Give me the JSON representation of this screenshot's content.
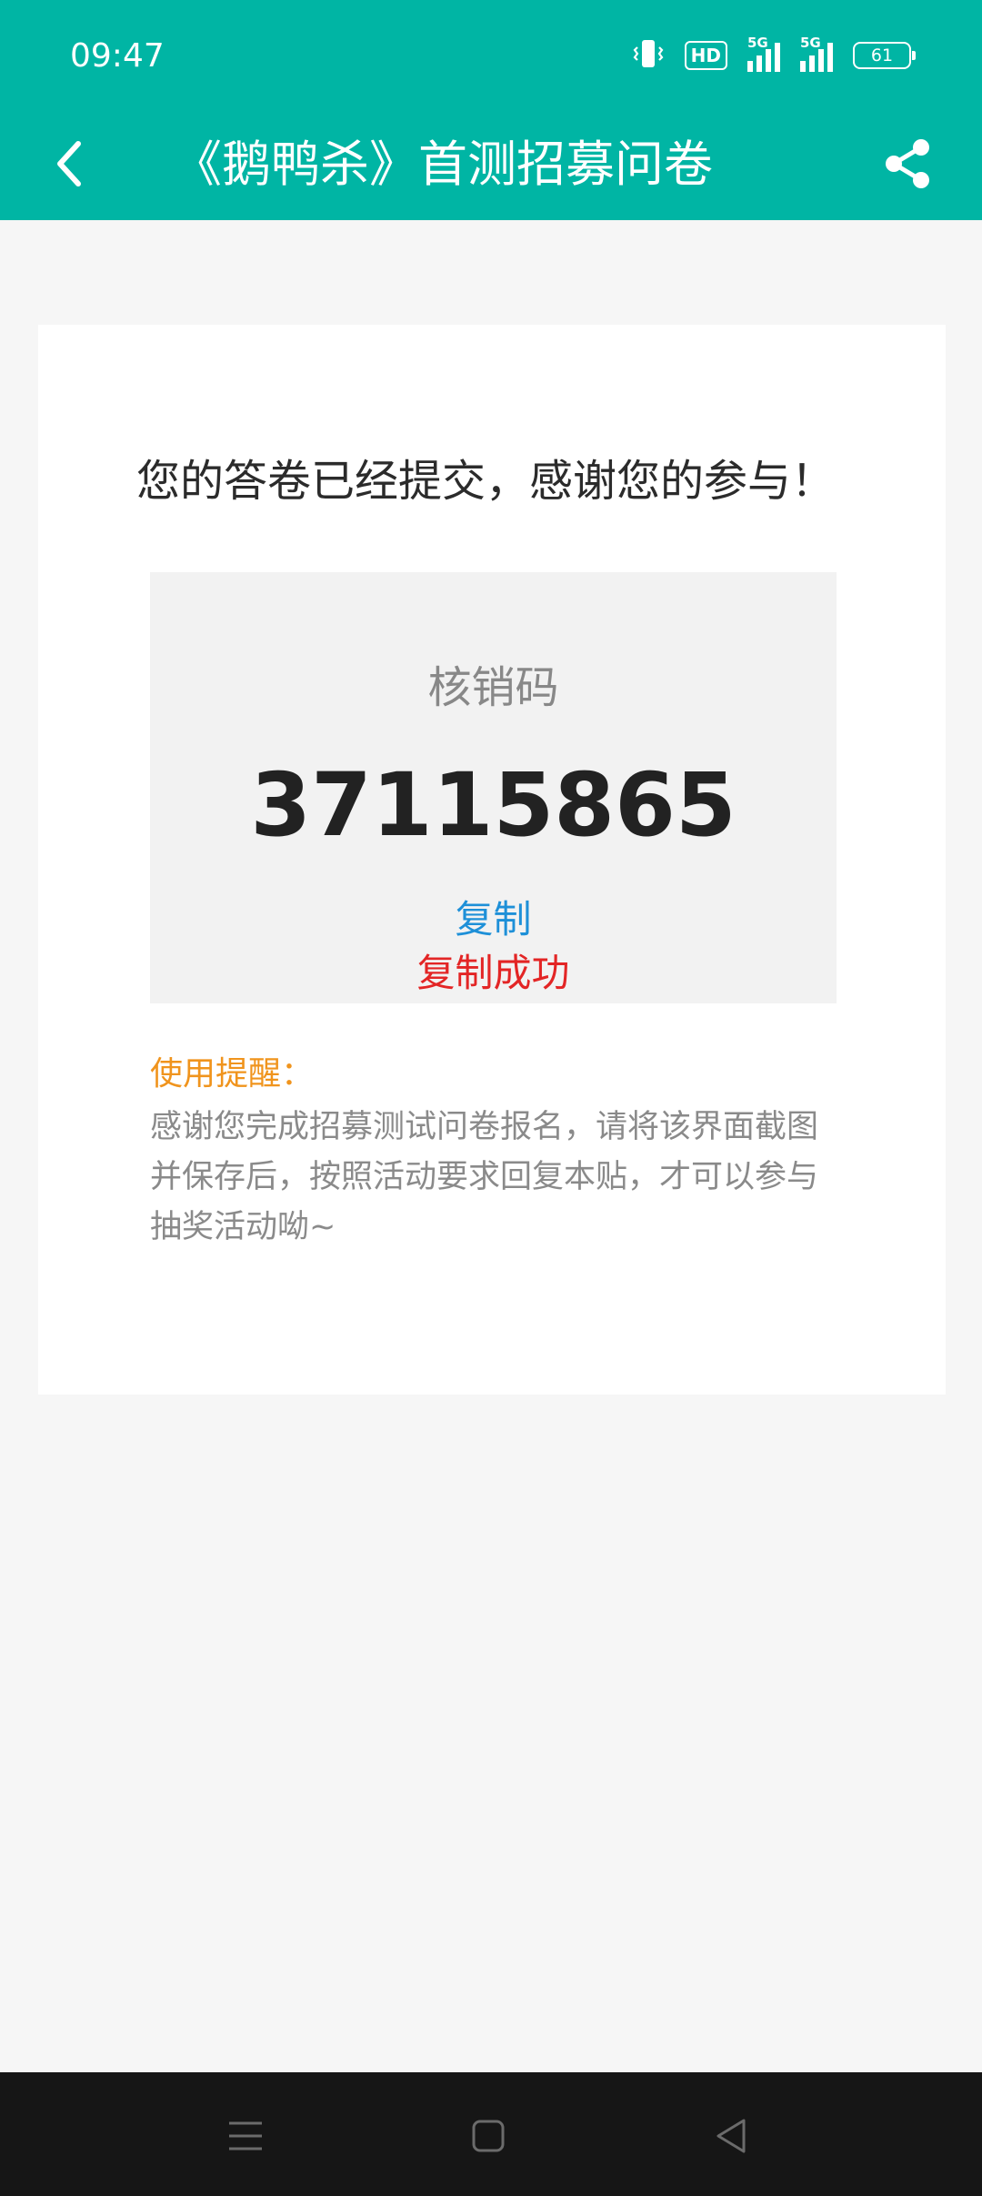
{
  "status_bar": {
    "time": "09:47",
    "hd_label": "HD",
    "signal_1_label": "5G",
    "signal_2_label": "5G",
    "battery_level": "61"
  },
  "nav": {
    "title": "《鹅鸭杀》首测招募问卷",
    "icons": {
      "back": "back-chevron-icon",
      "share": "share-icon"
    }
  },
  "main": {
    "headline": "您的答卷已经提交，感谢您的参与！",
    "code_label": "核销码",
    "code_value": "37115865",
    "copy_label": "复制",
    "copy_success": "复制成功",
    "tip_title": "使用提醒：",
    "tip_text": "感谢您完成招募测试问卷报名，请将该界面截图并保存后，按照活动要求回复本贴，才可以参与抽奖活动呦~"
  },
  "system_nav": {
    "icons": [
      "menu-icon",
      "home-icon",
      "back-triangle-icon"
    ]
  },
  "colors": {
    "primary": "#00b5a4",
    "link": "#1e90d8",
    "success": "#e32525",
    "tip": "#f0941d",
    "background": "#f6f6f6"
  }
}
